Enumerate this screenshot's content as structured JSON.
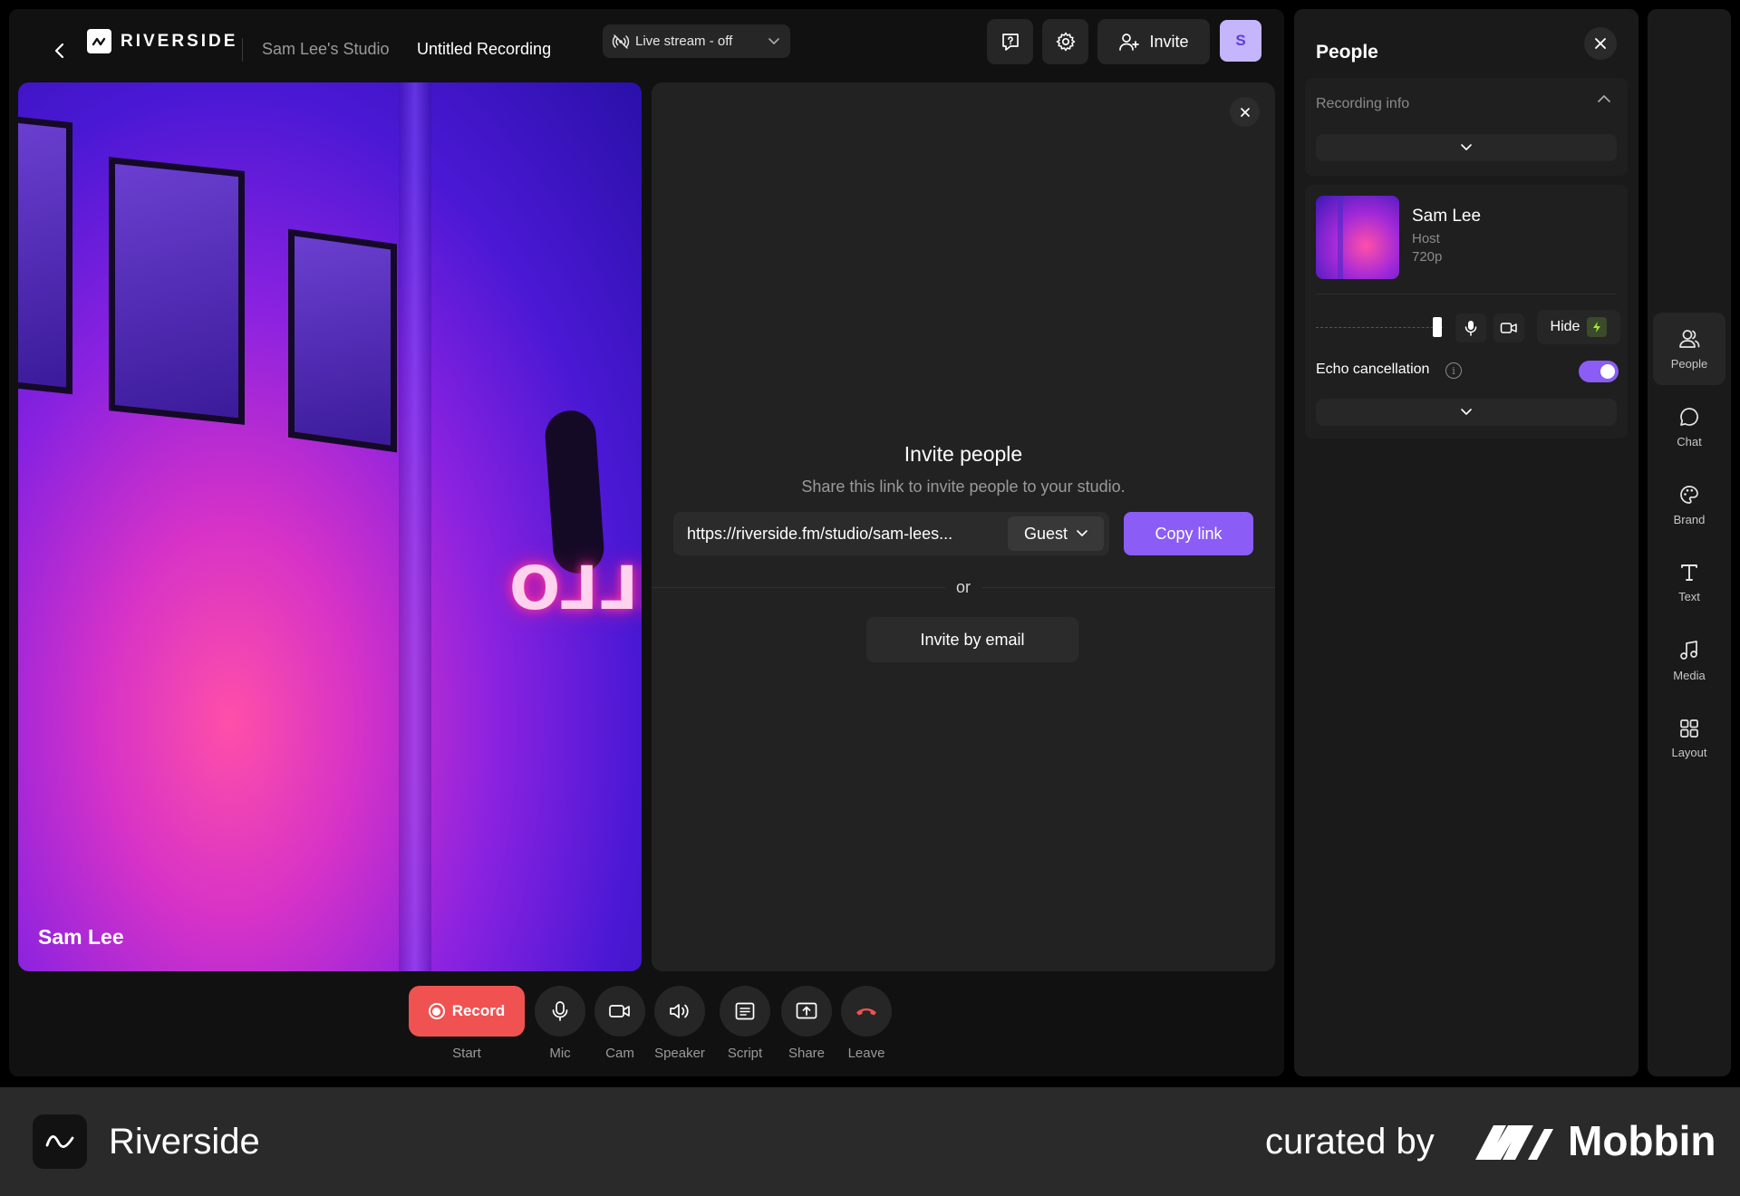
{
  "header": {
    "brand": "RIVERSIDE",
    "studio_name": "Sam Lee's Studio",
    "recording_title": "Untitled Recording",
    "livestream_label": "Live stream - off",
    "invite_label": "Invite",
    "avatar_initial": "S"
  },
  "video": {
    "participant_name": "Sam Lee",
    "neon_text": "HELLO"
  },
  "invite_panel": {
    "title": "Invite people",
    "subtitle": "Share this link to invite people to your studio.",
    "link": "https://riverside.fm/studio/sam-lees...",
    "role": "Guest",
    "copy_label": "Copy link",
    "or_label": "or",
    "email_label": "Invite by email"
  },
  "controls": [
    {
      "label": "Start",
      "button": "Record"
    },
    {
      "label": "Mic"
    },
    {
      "label": "Cam"
    },
    {
      "label": "Speaker"
    },
    {
      "label": "Script"
    },
    {
      "label": "Share"
    },
    {
      "label": "Leave"
    }
  ],
  "people_panel": {
    "title": "People",
    "recording_info_label": "Recording info",
    "participant": {
      "name": "Sam Lee",
      "role": "Host",
      "resolution": "720p"
    },
    "volume_level": 0.95,
    "hide_label": "Hide",
    "echo_label": "Echo cancellation",
    "echo_enabled": true
  },
  "rail": [
    {
      "label": "People",
      "active": true
    },
    {
      "label": "Chat"
    },
    {
      "label": "Brand"
    },
    {
      "label": "Text"
    },
    {
      "label": "Media"
    },
    {
      "label": "Layout"
    }
  ],
  "footer": {
    "app_name": "Riverside",
    "curated_by": "curated by",
    "curator": "Mobbin"
  },
  "colors": {
    "accent": "#8b5cf6",
    "record": "#f05252",
    "avatar_bg": "#c4b5fd",
    "leave_icon": "#f05252"
  }
}
